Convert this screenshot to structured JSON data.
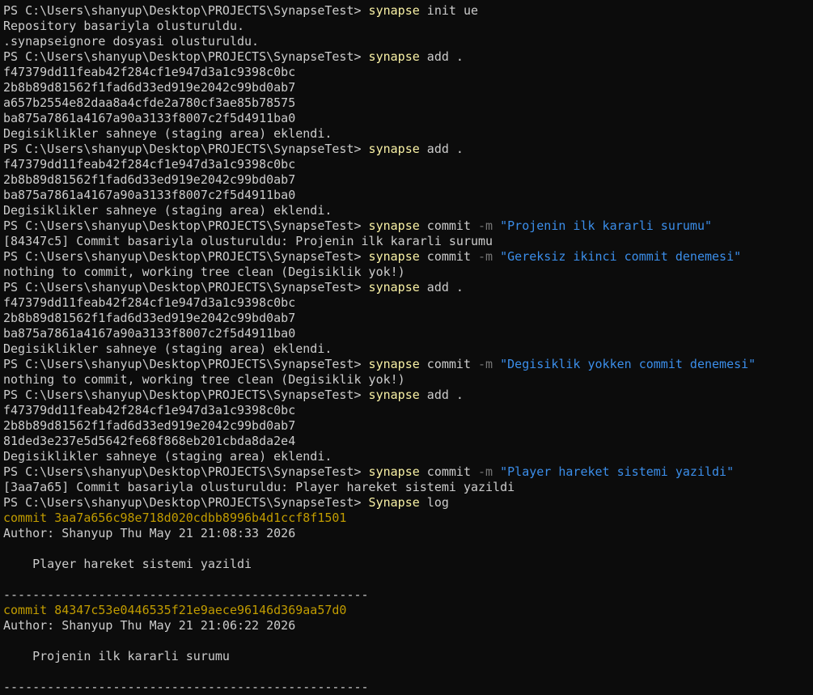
{
  "terminal": {
    "colors": {
      "background": "#0c0c0c",
      "foreground": "#cccccc",
      "command": "#f9f1a5",
      "flag": "#767676",
      "string": "#3b8eea",
      "commit_hash": "#c19c00"
    },
    "lines": [
      {
        "kind": "prompt",
        "segments": [
          {
            "t": "prompt",
            "v": "PS C:\\Users\\shanyup\\Desktop\\PROJECTS\\SynapseTest> "
          },
          {
            "t": "cmd",
            "v": "synapse"
          },
          {
            "t": "arg",
            "v": " init ue"
          }
        ]
      },
      {
        "kind": "output",
        "segments": [
          {
            "t": "out",
            "v": "Repository basariyla olusturuldu."
          }
        ]
      },
      {
        "kind": "output",
        "segments": [
          {
            "t": "out",
            "v": ".synapseignore dosyasi olusturuldu."
          }
        ]
      },
      {
        "kind": "prompt",
        "segments": [
          {
            "t": "prompt",
            "v": "PS C:\\Users\\shanyup\\Desktop\\PROJECTS\\SynapseTest> "
          },
          {
            "t": "cmd",
            "v": "synapse"
          },
          {
            "t": "arg",
            "v": " add ."
          }
        ]
      },
      {
        "kind": "output",
        "segments": [
          {
            "t": "out",
            "v": "f47379dd11feab42f284cf1e947d3a1c9398c0bc"
          }
        ]
      },
      {
        "kind": "output",
        "segments": [
          {
            "t": "out",
            "v": "2b8b89d81562f1fad6d33ed919e2042c99bd0ab7"
          }
        ]
      },
      {
        "kind": "output",
        "segments": [
          {
            "t": "out",
            "v": "a657b2554e82daa8a4cfde2a780cf3ae85b78575"
          }
        ]
      },
      {
        "kind": "output",
        "segments": [
          {
            "t": "out",
            "v": "ba875a7861a4167a90a3133f8007c2f5d4911ba0"
          }
        ]
      },
      {
        "kind": "output",
        "segments": [
          {
            "t": "out",
            "v": "Degisiklikler sahneye (staging area) eklendi."
          }
        ]
      },
      {
        "kind": "prompt",
        "segments": [
          {
            "t": "prompt",
            "v": "PS C:\\Users\\shanyup\\Desktop\\PROJECTS\\SynapseTest> "
          },
          {
            "t": "cmd",
            "v": "synapse"
          },
          {
            "t": "arg",
            "v": " add ."
          }
        ]
      },
      {
        "kind": "output",
        "segments": [
          {
            "t": "out",
            "v": "f47379dd11feab42f284cf1e947d3a1c9398c0bc"
          }
        ]
      },
      {
        "kind": "output",
        "segments": [
          {
            "t": "out",
            "v": "2b8b89d81562f1fad6d33ed919e2042c99bd0ab7"
          }
        ]
      },
      {
        "kind": "output",
        "segments": [
          {
            "t": "out",
            "v": "ba875a7861a4167a90a3133f8007c2f5d4911ba0"
          }
        ]
      },
      {
        "kind": "output",
        "segments": [
          {
            "t": "out",
            "v": "Degisiklikler sahneye (staging area) eklendi."
          }
        ]
      },
      {
        "kind": "prompt",
        "segments": [
          {
            "t": "prompt",
            "v": "PS C:\\Users\\shanyup\\Desktop\\PROJECTS\\SynapseTest> "
          },
          {
            "t": "cmd",
            "v": "synapse"
          },
          {
            "t": "arg",
            "v": " commit "
          },
          {
            "t": "flag",
            "v": "-m"
          },
          {
            "t": "arg",
            "v": " "
          },
          {
            "t": "str",
            "v": "\"Projenin ilk kararli surumu\""
          }
        ]
      },
      {
        "kind": "output",
        "segments": [
          {
            "t": "out",
            "v": "[84347c5] Commit basariyla olusturuldu: Projenin ilk kararli surumu"
          }
        ]
      },
      {
        "kind": "prompt",
        "segments": [
          {
            "t": "prompt",
            "v": "PS C:\\Users\\shanyup\\Desktop\\PROJECTS\\SynapseTest> "
          },
          {
            "t": "cmd",
            "v": "synapse"
          },
          {
            "t": "arg",
            "v": " commit "
          },
          {
            "t": "flag",
            "v": "-m"
          },
          {
            "t": "arg",
            "v": " "
          },
          {
            "t": "str",
            "v": "\"Gereksiz ikinci commit denemesi\""
          }
        ]
      },
      {
        "kind": "output",
        "segments": [
          {
            "t": "out",
            "v": "nothing to commit, working tree clean (Degisiklik yok!)"
          }
        ]
      },
      {
        "kind": "prompt",
        "segments": [
          {
            "t": "prompt",
            "v": "PS C:\\Users\\shanyup\\Desktop\\PROJECTS\\SynapseTest> "
          },
          {
            "t": "cmd",
            "v": "synapse"
          },
          {
            "t": "arg",
            "v": " add ."
          }
        ]
      },
      {
        "kind": "output",
        "segments": [
          {
            "t": "out",
            "v": "f47379dd11feab42f284cf1e947d3a1c9398c0bc"
          }
        ]
      },
      {
        "kind": "output",
        "segments": [
          {
            "t": "out",
            "v": "2b8b89d81562f1fad6d33ed919e2042c99bd0ab7"
          }
        ]
      },
      {
        "kind": "output",
        "segments": [
          {
            "t": "out",
            "v": "ba875a7861a4167a90a3133f8007c2f5d4911ba0"
          }
        ]
      },
      {
        "kind": "output",
        "segments": [
          {
            "t": "out",
            "v": "Degisiklikler sahneye (staging area) eklendi."
          }
        ]
      },
      {
        "kind": "prompt",
        "segments": [
          {
            "t": "prompt",
            "v": "PS C:\\Users\\shanyup\\Desktop\\PROJECTS\\SynapseTest> "
          },
          {
            "t": "cmd",
            "v": "synapse"
          },
          {
            "t": "arg",
            "v": " commit "
          },
          {
            "t": "flag",
            "v": "-m"
          },
          {
            "t": "arg",
            "v": " "
          },
          {
            "t": "str",
            "v": "\"Degisiklik yokken commit denemesi\""
          }
        ]
      },
      {
        "kind": "output",
        "segments": [
          {
            "t": "out",
            "v": "nothing to commit, working tree clean (Degisiklik yok!)"
          }
        ]
      },
      {
        "kind": "prompt",
        "segments": [
          {
            "t": "prompt",
            "v": "PS C:\\Users\\shanyup\\Desktop\\PROJECTS\\SynapseTest> "
          },
          {
            "t": "cmd",
            "v": "synapse"
          },
          {
            "t": "arg",
            "v": " add ."
          }
        ]
      },
      {
        "kind": "output",
        "segments": [
          {
            "t": "out",
            "v": "f47379dd11feab42f284cf1e947d3a1c9398c0bc"
          }
        ]
      },
      {
        "kind": "output",
        "segments": [
          {
            "t": "out",
            "v": "2b8b89d81562f1fad6d33ed919e2042c99bd0ab7"
          }
        ]
      },
      {
        "kind": "output",
        "segments": [
          {
            "t": "out",
            "v": "81ded3e237e5d5642fe68f868eb201cbda8da2e4"
          }
        ]
      },
      {
        "kind": "output",
        "segments": [
          {
            "t": "out",
            "v": "Degisiklikler sahneye (staging area) eklendi."
          }
        ]
      },
      {
        "kind": "prompt",
        "segments": [
          {
            "t": "prompt",
            "v": "PS C:\\Users\\shanyup\\Desktop\\PROJECTS\\SynapseTest> "
          },
          {
            "t": "cmd",
            "v": "synapse"
          },
          {
            "t": "arg",
            "v": " commit "
          },
          {
            "t": "flag",
            "v": "-m"
          },
          {
            "t": "arg",
            "v": " "
          },
          {
            "t": "str",
            "v": "\"Player hareket sistemi yazildi\""
          }
        ]
      },
      {
        "kind": "output",
        "segments": [
          {
            "t": "out",
            "v": "[3aa7a65] Commit basariyla olusturuldu: Player hareket sistemi yazildi"
          }
        ]
      },
      {
        "kind": "prompt",
        "segments": [
          {
            "t": "prompt",
            "v": "PS C:\\Users\\shanyup\\Desktop\\PROJECTS\\SynapseTest> "
          },
          {
            "t": "cmd",
            "v": "Synapse"
          },
          {
            "t": "arg",
            "v": " log"
          }
        ]
      },
      {
        "kind": "commit",
        "segments": [
          {
            "t": "commit",
            "v": "commit 3aa7a656c98e718d020cdbb8996b4d1ccf8f1501"
          }
        ]
      },
      {
        "kind": "output",
        "segments": [
          {
            "t": "out",
            "v": "Author: Shanyup Thu May 21 21:08:33 2026"
          }
        ]
      },
      {
        "kind": "blank",
        "segments": [
          {
            "t": "out",
            "v": ""
          }
        ]
      },
      {
        "kind": "output",
        "segments": [
          {
            "t": "out",
            "v": "    Player hareket sistemi yazildi"
          }
        ]
      },
      {
        "kind": "blank",
        "segments": [
          {
            "t": "out",
            "v": ""
          }
        ]
      },
      {
        "kind": "separator",
        "segments": [
          {
            "t": "sep",
            "v": "--------------------------------------------------"
          }
        ]
      },
      {
        "kind": "commit",
        "segments": [
          {
            "t": "commit",
            "v": "commit 84347c53e0446535f21e9aece96146d369aa57d0"
          }
        ]
      },
      {
        "kind": "output",
        "segments": [
          {
            "t": "out",
            "v": "Author: Shanyup Thu May 21 21:06:22 2026"
          }
        ]
      },
      {
        "kind": "blank",
        "segments": [
          {
            "t": "out",
            "v": ""
          }
        ]
      },
      {
        "kind": "output",
        "segments": [
          {
            "t": "out",
            "v": "    Projenin ilk kararli surumu"
          }
        ]
      },
      {
        "kind": "blank",
        "segments": [
          {
            "t": "out",
            "v": ""
          }
        ]
      },
      {
        "kind": "separator",
        "segments": [
          {
            "t": "sep",
            "v": "--------------------------------------------------"
          }
        ]
      }
    ]
  }
}
